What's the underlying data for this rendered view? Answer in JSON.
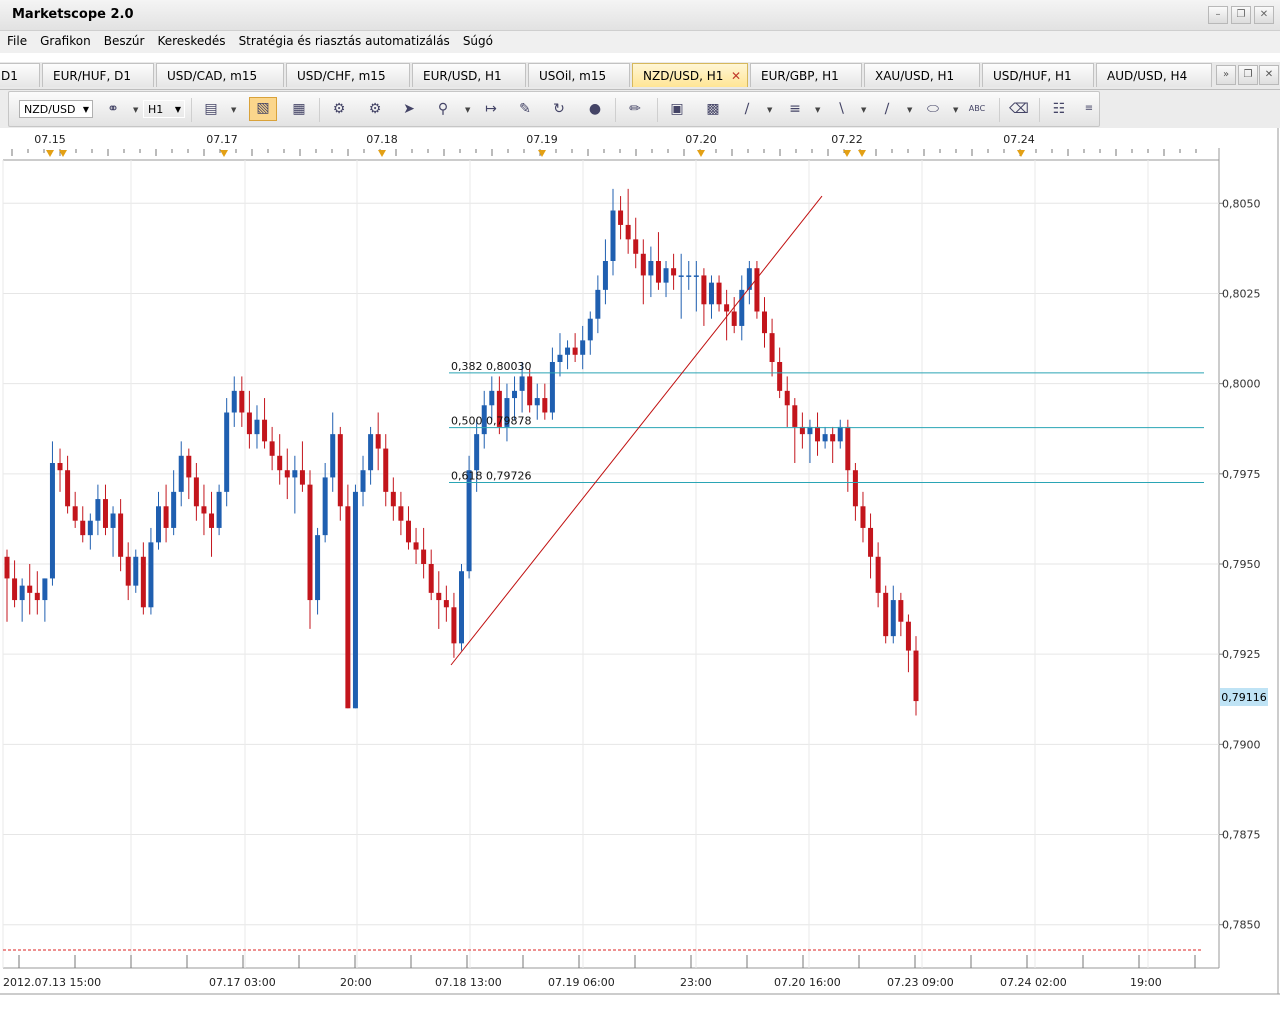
{
  "window": {
    "title": "Marketscope 2.0"
  },
  "menu": [
    "File",
    "Grafikon",
    "Beszúr",
    "Kereskedés",
    "Stratégia és riasztás automatizálás",
    "Súgó"
  ],
  "tabs": [
    {
      "label": "D1",
      "active": false
    },
    {
      "label": "EUR/HUF, D1",
      "active": false
    },
    {
      "label": "USD/CAD, m15",
      "active": false
    },
    {
      "label": "USD/CHF, m15",
      "active": false
    },
    {
      "label": "EUR/USD, H1",
      "active": false
    },
    {
      "label": "USOil, m15",
      "active": false
    },
    {
      "label": "NZD/USD, H1",
      "active": true
    },
    {
      "label": "EUR/GBP, H1",
      "active": false
    },
    {
      "label": "XAU/USD, H1",
      "active": false
    },
    {
      "label": "USD/HUF, H1",
      "active": false
    },
    {
      "label": "AUD/USD, H4",
      "active": false
    }
  ],
  "toolbar": {
    "instrument": "NZD/USD",
    "timeframe": "H1"
  },
  "chart": {
    "top_date_labels": [
      "07.15",
      "07.17",
      "07.18",
      "07.19",
      "07.20",
      "07.22",
      "07.24"
    ],
    "y_ticks": [
      "0,8050",
      "0,8025",
      "0,8000",
      "0,7975",
      "0,7950",
      "0,7925",
      "0,7900",
      "0,7875",
      "0,7850"
    ],
    "x_ticks": [
      "2012.07.13 15:00",
      "07.17 03:00",
      "20:00",
      "07.18 13:00",
      "07.19 06:00",
      "23:00",
      "07.20 16:00",
      "07.23 09:00",
      "07.24 02:00",
      "19:00"
    ],
    "current_price": "0,79116",
    "fib_labels": [
      "0,382 0,80030",
      "0,500 0,79878",
      "0,618 0,79726"
    ],
    "colors": {
      "bull": "#1f5fb0",
      "bear": "#c3151c",
      "fib": "#2aa5b5",
      "trend": "#c01010",
      "price_tag": "#bfe3f5"
    }
  },
  "chart_data": {
    "type": "candlestick",
    "title": "",
    "xlabel": "",
    "ylabel": "",
    "ylim": [
      0.7838,
      0.8062
    ],
    "candles": [
      [
        0.7952,
        0.7954,
        0.7934,
        0.7946
      ],
      [
        0.7946,
        0.7951,
        0.7938,
        0.794
      ],
      [
        0.794,
        0.7946,
        0.7934,
        0.7944
      ],
      [
        0.7944,
        0.795,
        0.7936,
        0.7942
      ],
      [
        0.7942,
        0.7948,
        0.7936,
        0.794
      ],
      [
        0.794,
        0.7946,
        0.7934,
        0.7946
      ],
      [
        0.7946,
        0.7984,
        0.7944,
        0.7978
      ],
      [
        0.7978,
        0.7982,
        0.797,
        0.7976
      ],
      [
        0.7976,
        0.798,
        0.7964,
        0.7966
      ],
      [
        0.7966,
        0.797,
        0.796,
        0.7962
      ],
      [
        0.7962,
        0.7966,
        0.7956,
        0.7958
      ],
      [
        0.7958,
        0.7964,
        0.7954,
        0.7962
      ],
      [
        0.7962,
        0.7972,
        0.7958,
        0.7968
      ],
      [
        0.7968,
        0.7972,
        0.7958,
        0.796
      ],
      [
        0.796,
        0.7966,
        0.7952,
        0.7964
      ],
      [
        0.7964,
        0.7968,
        0.7948,
        0.7952
      ],
      [
        0.7952,
        0.7956,
        0.794,
        0.7944
      ],
      [
        0.7944,
        0.7954,
        0.7942,
        0.7952
      ],
      [
        0.7952,
        0.7956,
        0.7936,
        0.7938
      ],
      [
        0.7938,
        0.796,
        0.7936,
        0.7956
      ],
      [
        0.7956,
        0.797,
        0.7954,
        0.7966
      ],
      [
        0.7966,
        0.7972,
        0.7956,
        0.796
      ],
      [
        0.796,
        0.7976,
        0.7958,
        0.797
      ],
      [
        0.797,
        0.7984,
        0.7966,
        0.798
      ],
      [
        0.798,
        0.7982,
        0.7968,
        0.7974
      ],
      [
        0.7974,
        0.7978,
        0.7962,
        0.7966
      ],
      [
        0.7966,
        0.7972,
        0.7958,
        0.7964
      ],
      [
        0.7964,
        0.797,
        0.7952,
        0.796
      ],
      [
        0.796,
        0.7972,
        0.7958,
        0.797
      ],
      [
        0.797,
        0.7996,
        0.7966,
        0.7992
      ],
      [
        0.7992,
        0.8002,
        0.7988,
        0.7998
      ],
      [
        0.7998,
        0.8002,
        0.7988,
        0.7992
      ],
      [
        0.7992,
        0.7998,
        0.7982,
        0.7986
      ],
      [
        0.7986,
        0.7994,
        0.7982,
        0.799
      ],
      [
        0.799,
        0.7996,
        0.7982,
        0.7984
      ],
      [
        0.7984,
        0.7988,
        0.7976,
        0.798
      ],
      [
        0.798,
        0.7986,
        0.7972,
        0.7976
      ],
      [
        0.7976,
        0.7982,
        0.7968,
        0.7974
      ],
      [
        0.7974,
        0.798,
        0.7964,
        0.7976
      ],
      [
        0.7976,
        0.7984,
        0.797,
        0.7972
      ],
      [
        0.7972,
        0.7976,
        0.7932,
        0.794
      ],
      [
        0.794,
        0.796,
        0.7936,
        0.7958
      ],
      [
        0.7958,
        0.7978,
        0.7956,
        0.7974
      ],
      [
        0.7974,
        0.7992,
        0.797,
        0.7986
      ],
      [
        0.7986,
        0.7988,
        0.7962,
        0.7966
      ],
      [
        0.7966,
        0.7972,
        0.791,
        0.791
      ],
      [
        0.791,
        0.7972,
        0.791,
        0.797
      ],
      [
        0.797,
        0.798,
        0.7966,
        0.7976
      ],
      [
        0.7976,
        0.7988,
        0.7972,
        0.7986
      ],
      [
        0.7986,
        0.7992,
        0.7976,
        0.7982
      ],
      [
        0.7982,
        0.7986,
        0.7966,
        0.797
      ],
      [
        0.797,
        0.7974,
        0.7962,
        0.7966
      ],
      [
        0.7966,
        0.797,
        0.7958,
        0.7962
      ],
      [
        0.7962,
        0.7966,
        0.7954,
        0.7956
      ],
      [
        0.7956,
        0.796,
        0.795,
        0.7954
      ],
      [
        0.7954,
        0.796,
        0.7946,
        0.795
      ],
      [
        0.795,
        0.7954,
        0.794,
        0.7942
      ],
      [
        0.7942,
        0.7948,
        0.7932,
        0.794
      ],
      [
        0.794,
        0.7944,
        0.7934,
        0.7938
      ],
      [
        0.7938,
        0.7942,
        0.7924,
        0.7928
      ],
      [
        0.7928,
        0.795,
        0.7926,
        0.7948
      ],
      [
        0.7948,
        0.798,
        0.7946,
        0.7976
      ],
      [
        0.7976,
        0.799,
        0.797,
        0.7986
      ],
      [
        0.7986,
        0.7998,
        0.7982,
        0.7994
      ],
      [
        0.7994,
        0.8002,
        0.799,
        0.7998
      ],
      [
        0.7998,
        0.8002,
        0.7986,
        0.7988
      ],
      [
        0.7988,
        0.8,
        0.7984,
        0.7996
      ],
      [
        0.7996,
        0.8002,
        0.799,
        0.7998
      ],
      [
        0.7998,
        0.8006,
        0.7992,
        0.8002
      ],
      [
        0.8002,
        0.8004,
        0.7992,
        0.7994
      ],
      [
        0.7994,
        0.8,
        0.799,
        0.7996
      ],
      [
        0.7996,
        0.8,
        0.799,
        0.7992
      ],
      [
        0.7992,
        0.801,
        0.799,
        0.8006
      ],
      [
        0.8006,
        0.8014,
        0.8002,
        0.8008
      ],
      [
        0.8008,
        0.8012,
        0.8004,
        0.801
      ],
      [
        0.801,
        0.8014,
        0.8006,
        0.8008
      ],
      [
        0.8008,
        0.8016,
        0.8004,
        0.8012
      ],
      [
        0.8012,
        0.802,
        0.8008,
        0.8018
      ],
      [
        0.8018,
        0.803,
        0.8014,
        0.8026
      ],
      [
        0.8026,
        0.804,
        0.8022,
        0.8034
      ],
      [
        0.8034,
        0.8054,
        0.803,
        0.8048
      ],
      [
        0.8048,
        0.8052,
        0.804,
        0.8044
      ],
      [
        0.8044,
        0.8054,
        0.8036,
        0.804
      ],
      [
        0.804,
        0.8046,
        0.8032,
        0.8036
      ],
      [
        0.8036,
        0.804,
        0.8022,
        0.803
      ],
      [
        0.803,
        0.8038,
        0.8024,
        0.8034
      ],
      [
        0.8034,
        0.8042,
        0.8026,
        0.8028
      ],
      [
        0.8028,
        0.8034,
        0.8024,
        0.8032
      ],
      [
        0.8032,
        0.8036,
        0.8026,
        0.803
      ],
      [
        0.803,
        0.8036,
        0.8018,
        0.803
      ],
      [
        0.803,
        0.8034,
        0.8026,
        0.803
      ],
      [
        0.803,
        0.8034,
        0.802,
        0.803
      ],
      [
        0.803,
        0.8032,
        0.8016,
        0.8022
      ],
      [
        0.8022,
        0.803,
        0.8018,
        0.8028
      ],
      [
        0.8028,
        0.803,
        0.802,
        0.8022
      ],
      [
        0.8022,
        0.8026,
        0.8012,
        0.802
      ],
      [
        0.802,
        0.8024,
        0.8014,
        0.8016
      ],
      [
        0.8016,
        0.803,
        0.8012,
        0.8026
      ],
      [
        0.8026,
        0.8034,
        0.8022,
        0.8032
      ],
      [
        0.8032,
        0.8034,
        0.8018,
        0.802
      ],
      [
        0.802,
        0.8024,
        0.801,
        0.8014
      ],
      [
        0.8014,
        0.8018,
        0.8002,
        0.8006
      ],
      [
        0.8006,
        0.801,
        0.7996,
        0.7998
      ],
      [
        0.7998,
        0.8002,
        0.7988,
        0.7994
      ],
      [
        0.7994,
        0.7996,
        0.7978,
        0.7988
      ],
      [
        0.7988,
        0.7992,
        0.7982,
        0.7986
      ],
      [
        0.7986,
        0.799,
        0.7978,
        0.7988
      ],
      [
        0.7988,
        0.7992,
        0.798,
        0.7984
      ],
      [
        0.7984,
        0.7988,
        0.7982,
        0.7986
      ],
      [
        0.7986,
        0.7988,
        0.7978,
        0.7984
      ],
      [
        0.7984,
        0.799,
        0.7982,
        0.7988
      ],
      [
        0.7988,
        0.799,
        0.797,
        0.7976
      ],
      [
        0.7976,
        0.7978,
        0.7962,
        0.7966
      ],
      [
        0.7966,
        0.797,
        0.7956,
        0.796
      ],
      [
        0.796,
        0.7964,
        0.7946,
        0.7952
      ],
      [
        0.7952,
        0.7956,
        0.7938,
        0.7942
      ],
      [
        0.7942,
        0.7944,
        0.7928,
        0.793
      ],
      [
        0.793,
        0.7944,
        0.7928,
        0.794
      ],
      [
        0.794,
        0.7942,
        0.793,
        0.7934
      ],
      [
        0.7934,
        0.7936,
        0.792,
        0.7926
      ],
      [
        0.7926,
        0.793,
        0.7908,
        0.7912
      ]
    ],
    "fib_levels": [
      {
        "ratio": 0.382,
        "price": 0.8003
      },
      {
        "ratio": 0.5,
        "price": 0.79878
      },
      {
        "ratio": 0.618,
        "price": 0.79726
      }
    ],
    "trendline": [
      [
        0.7922,
        0.8052
      ]
    ],
    "last_price": 0.79116,
    "grid": true
  }
}
